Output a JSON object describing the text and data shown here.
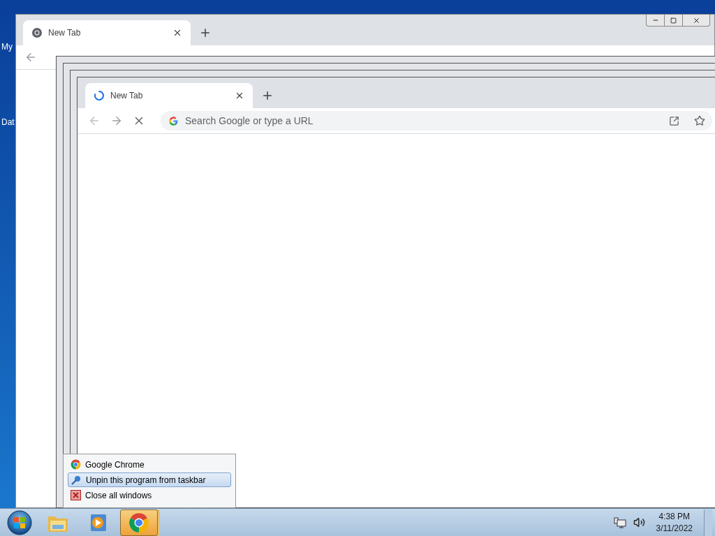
{
  "desktop_icons": [
    {
      "label": "My"
    },
    {
      "label": "Dat"
    }
  ],
  "back_window": {
    "tab": {
      "title": "New Tab",
      "loading": false
    }
  },
  "front_window": {
    "tab": {
      "title": "New Tab",
      "loading": true
    },
    "omnibox": {
      "placeholder": "Search Google or type a URL"
    }
  },
  "jump_list": {
    "items": [
      {
        "label": "Google Chrome",
        "kind": "app",
        "selected": false
      },
      {
        "label": "Unpin this program from taskbar",
        "kind": "unpin",
        "selected": true
      },
      {
        "label": "Close all windows",
        "kind": "close",
        "selected": false
      }
    ]
  },
  "taskbar": {
    "apps": [
      {
        "kind": "explorer",
        "active": false
      },
      {
        "kind": "media",
        "active": false
      },
      {
        "kind": "chrome",
        "active": true
      }
    ],
    "clock": {
      "time": "4:38 PM",
      "date": "3/11/2022"
    }
  }
}
